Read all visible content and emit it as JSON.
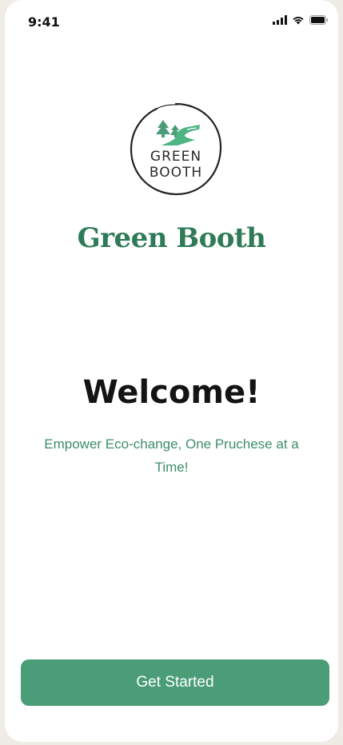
{
  "status_bar": {
    "time": "9:41",
    "icons": [
      "cellular-signal-icon",
      "wifi-icon",
      "battery-icon"
    ]
  },
  "logo": {
    "line1": "GREEN",
    "line2": "BOOTH",
    "icon": "trees-river-icon"
  },
  "brand": {
    "name": "Green Booth"
  },
  "welcome": {
    "title": "Welcome!",
    "tagline": "Empower Eco-change, One Pruchese at a Time!"
  },
  "actions": {
    "get_started_label": "Get Started"
  },
  "colors": {
    "brand_green": "#2f7a57",
    "button_green": "#4a9d77",
    "tagline_green": "#3e8e69",
    "background": "#ffffff",
    "outer_background": "#efece6"
  }
}
